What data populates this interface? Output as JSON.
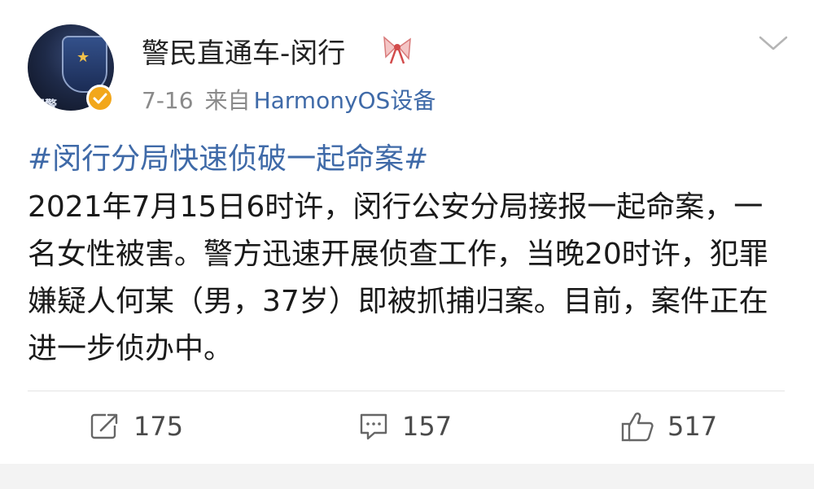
{
  "post": {
    "username": "警民直通车-闵行",
    "date": "7-16",
    "source_prefix": "来自",
    "device": "HarmonyOS设备",
    "hashtag": "#闵行分局快速侦破一起命案#",
    "body": "2021年7月15日6时许，闵行公安分局接报一起命案，一名女性被害。警方迅速开展侦查工作，当晚20时许，犯罪嫌疑人何某（男，37岁）即被抓捕归案。目前，案件正在进一步侦办中。",
    "avatar_text": "闵警"
  },
  "actions": {
    "repost_count": "175",
    "comment_count": "157",
    "like_count": "517"
  },
  "icons": {
    "repost": "repost-icon",
    "comment": "comment-icon",
    "like": "thumbs-up-icon",
    "more": "chevron-down-icon",
    "verified": "verified-badge-icon",
    "decoration": "ribbon-icon"
  },
  "colors": {
    "link": "#3f6aa8",
    "meta": "#8a8a8a",
    "verified": "#f2a71b"
  }
}
